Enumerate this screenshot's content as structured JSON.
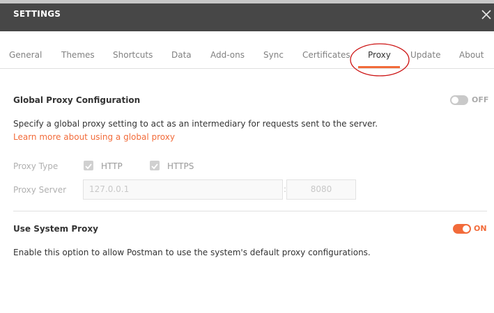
{
  "window": {
    "title": "SETTINGS"
  },
  "tabs": [
    {
      "label": "General"
    },
    {
      "label": "Themes"
    },
    {
      "label": "Shortcuts"
    },
    {
      "label": "Data"
    },
    {
      "label": "Add-ons"
    },
    {
      "label": "Sync"
    },
    {
      "label": "Certificates"
    },
    {
      "label": "Proxy",
      "active": true
    },
    {
      "label": "Update"
    },
    {
      "label": "About"
    }
  ],
  "global_proxy": {
    "title": "Global Proxy Configuration",
    "toggle_state": "OFF",
    "description": "Specify a global proxy setting to act as an intermediary for requests sent to the server.",
    "learn_more": "Learn more about using a global proxy",
    "proxy_type_label": "Proxy Type",
    "http_label": "HTTP",
    "https_label": "HTTPS",
    "http_checked": true,
    "https_checked": true,
    "server_label": "Proxy Server",
    "server_placeholder": "127.0.0.1",
    "port_placeholder": "8080",
    "separator": ":"
  },
  "system_proxy": {
    "title": "Use System Proxy",
    "toggle_state": "ON",
    "description": "Enable this option to allow Postman to use the system's default proxy configurations."
  },
  "colors": {
    "accent": "#f26b3a",
    "titlebar": "#474747",
    "annotation": "#cc1111"
  },
  "icons": {
    "close": "close-icon",
    "checkbox": "checkmark-icon"
  }
}
